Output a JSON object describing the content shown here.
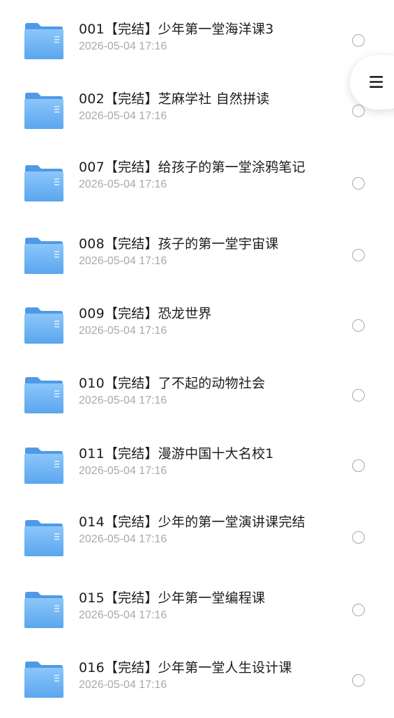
{
  "items": [
    {
      "name": "001【完结】少年第一堂海洋课3",
      "date": "2026-05-04 17:16"
    },
    {
      "name": "002【完结】芝麻学社 自然拼读",
      "date": "2026-05-04 17:16"
    },
    {
      "name": "007【完结】给孩子的第一堂涂鸦笔记",
      "date": "2026-05-04 17:16"
    },
    {
      "name": "008【完结】孩子的第一堂宇宙课",
      "date": "2026-05-04 17:16"
    },
    {
      "name": "009【完结】恐龙世界",
      "date": "2026-05-04 17:16"
    },
    {
      "name": "010【完结】了不起的动物社会",
      "date": "2026-05-04 17:16"
    },
    {
      "name": "011【完结】漫游中国十大名校1",
      "date": "2026-05-04 17:16"
    },
    {
      "name": "014【完结】少年的第一堂演讲课完结",
      "date": "2026-05-04 17:16"
    },
    {
      "name": "015【完结】少年第一堂编程课",
      "date": "2026-05-04 17:16"
    },
    {
      "name": "016【完结】少年第一堂人生设计课",
      "date": "2026-05-04 17:16"
    }
  ],
  "menu_button": {
    "icon": "menu-icon"
  },
  "colors": {
    "folder": "#6fb2f2",
    "title": "#1c1c1c",
    "date": "#a9a9a9",
    "radio": "#a8a8a8"
  }
}
